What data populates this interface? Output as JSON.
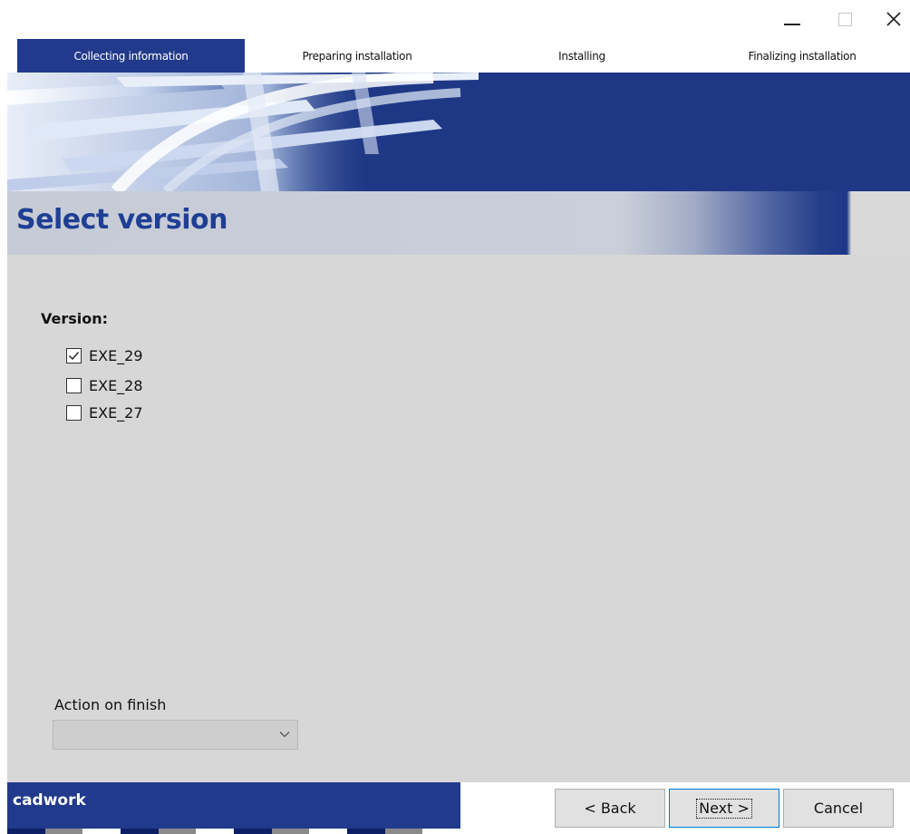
{
  "window": {
    "controls": {
      "minimize_icon": "minimize-icon",
      "maximize_icon": "maximize-icon",
      "close_icon": "close-icon"
    }
  },
  "steps": [
    {
      "label": "Collecting information",
      "active": true
    },
    {
      "label": "Preparing installation",
      "active": false
    },
    {
      "label": "Installing",
      "active": false
    },
    {
      "label": "Finalizing installation",
      "active": false
    }
  ],
  "page": {
    "title": "Select version"
  },
  "version": {
    "label": "Version:",
    "options": [
      {
        "label": "EXE_29",
        "checked": true
      },
      {
        "label": "EXE_28",
        "checked": false
      },
      {
        "label": "EXE_27",
        "checked": false
      }
    ]
  },
  "action_on_finish": {
    "label": "Action on finish",
    "value": ""
  },
  "footer": {
    "brand": "cadwork",
    "back_label": "< Back",
    "next_label": "Next >",
    "cancel_label": "Cancel"
  },
  "colors": {
    "accent_blue": "#213a8c",
    "title_blue": "#1f3f94",
    "panel_gray": "#d7d7d7"
  }
}
